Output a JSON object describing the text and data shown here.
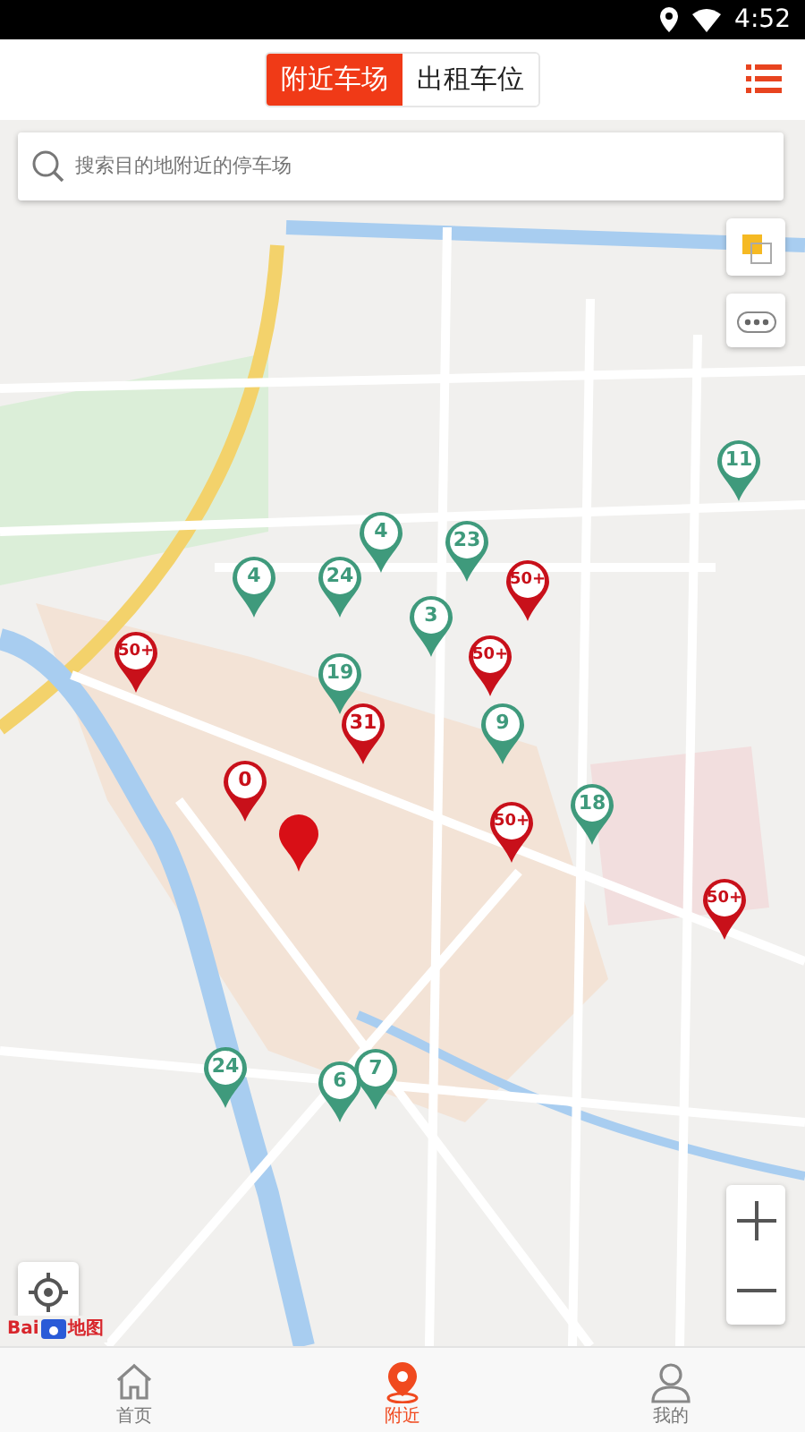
{
  "status_bar": {
    "time": "4:52"
  },
  "tabs": [
    {
      "label": "附近车场",
      "selected": true
    },
    {
      "label": "出租车位",
      "selected": false
    }
  ],
  "search": {
    "placeholder": "搜索目的地附近的停车场"
  },
  "pins": [
    {
      "count": "11",
      "color": "#3f9a7c"
    },
    {
      "count": "4",
      "color": "#3f9a7c"
    },
    {
      "count": "23",
      "color": "#3f9a7c"
    },
    {
      "count": "4",
      "color": "#3f9a7c"
    },
    {
      "count": "24",
      "color": "#3f9a7c"
    },
    {
      "count": "50+",
      "color": "#c8101a"
    },
    {
      "count": "3",
      "color": "#3f9a7c"
    },
    {
      "count": "50+",
      "color": "#c8101a"
    },
    {
      "count": "50+",
      "color": "#c8101a"
    },
    {
      "count": "19",
      "color": "#3f9a7c"
    },
    {
      "count": "31",
      "color": "#c8101a"
    },
    {
      "count": "9",
      "color": "#3f9a7c"
    },
    {
      "count": "0",
      "color": "#c8101a"
    },
    {
      "count": "18",
      "color": "#3f9a7c"
    },
    {
      "count": "50+",
      "color": "#c8101a"
    },
    {
      "count": "50+",
      "color": "#c8101a"
    },
    {
      "count": "24",
      "color": "#3f9a7c"
    },
    {
      "count": "7",
      "color": "#3f9a7c"
    },
    {
      "count": "6",
      "color": "#3f9a7c"
    }
  ],
  "map_logo": {
    "left": "Bai",
    "right": "地图"
  },
  "nav": [
    {
      "label": "首页",
      "selected": false
    },
    {
      "label": "附近",
      "selected": true
    },
    {
      "label": "我的",
      "selected": false
    }
  ]
}
